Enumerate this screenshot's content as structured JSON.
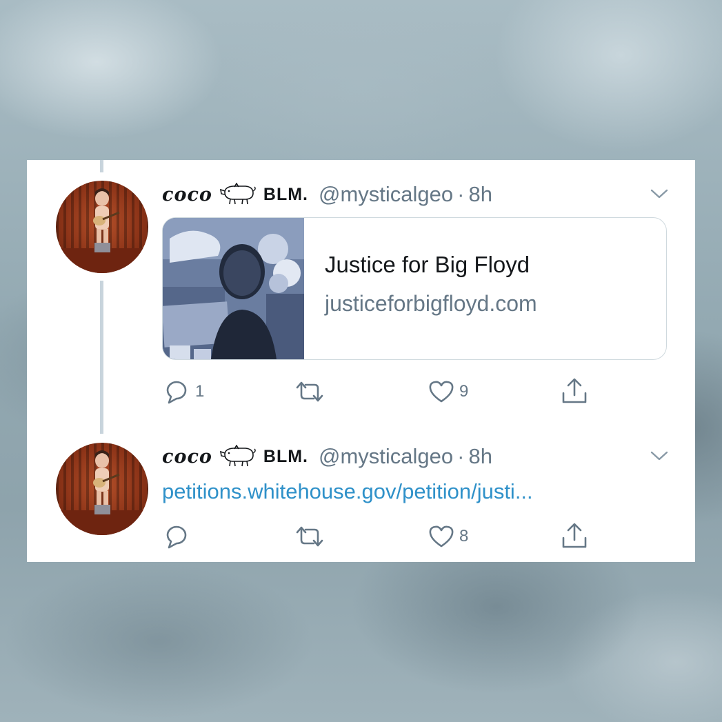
{
  "tweets": [
    {
      "author_name": "coco",
      "author_tag": "BLM.",
      "handle": "@mysticalgeo",
      "separator": "·",
      "time": "8h",
      "link_card": {
        "title": "Justice for Big Floyd",
        "domain": "justiceforbigfloyd.com"
      },
      "actions": {
        "reply_count": "1",
        "retweet_count": "",
        "like_count": "9"
      }
    },
    {
      "author_name": "coco",
      "author_tag": "BLM.",
      "handle": "@mysticalgeo",
      "separator": "·",
      "time": "8h",
      "link_text": "petitions.whitehouse.gov/petition/justi...",
      "actions": {
        "reply_count": "",
        "retweet_count": "",
        "like_count": "8"
      }
    }
  ],
  "colors": {
    "link": "#2f91c9",
    "secondary_text": "#657786",
    "primary_text": "#14171a",
    "thread_line": "#c8d4dc"
  },
  "icons": [
    "pig-emoji-icon",
    "chevron-down-icon",
    "reply-icon",
    "retweet-icon",
    "like-icon",
    "share-icon"
  ]
}
